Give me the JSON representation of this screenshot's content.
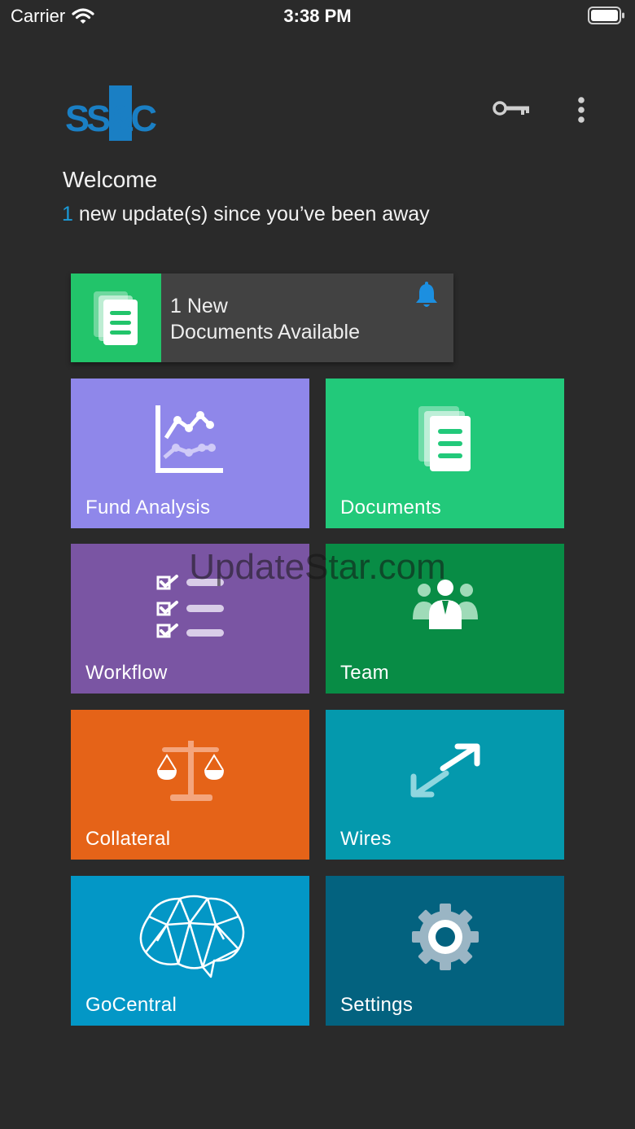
{
  "status_bar": {
    "carrier": "Carrier",
    "time": "3:38 PM"
  },
  "brand": {
    "logo_text": "SS&C",
    "logo_color": "#1a7fc4"
  },
  "header": {
    "welcome": "Welcome",
    "update_count": "1",
    "update_text": " new update(s) since you’ve been away"
  },
  "notification": {
    "line1": "1 New",
    "line2": "Documents Available",
    "icon": "documents-icon",
    "bell_icon": "bell-icon",
    "color": "#22c46a"
  },
  "tiles": [
    {
      "label": "Fund Analysis",
      "icon": "chart-icon",
      "color": "#8f87ea"
    },
    {
      "label": "Documents",
      "icon": "documents-icon",
      "color": "#22c97a"
    },
    {
      "label": "Workflow",
      "icon": "checklist-icon",
      "color": "#7a55a3"
    },
    {
      "label": "Team",
      "icon": "team-icon",
      "color": "#088c45"
    },
    {
      "label": "Collateral",
      "icon": "scale-icon",
      "color": "#e56318"
    },
    {
      "label": "Wires",
      "icon": "transfer-arrows-icon",
      "color": "#0499ad"
    },
    {
      "label": "GoCentral",
      "icon": "brain-icon",
      "color": "#0397c6"
    },
    {
      "label": "Settings",
      "icon": "gear-icon",
      "color": "#03627f"
    }
  ],
  "watermark": "UpdateStar.com"
}
